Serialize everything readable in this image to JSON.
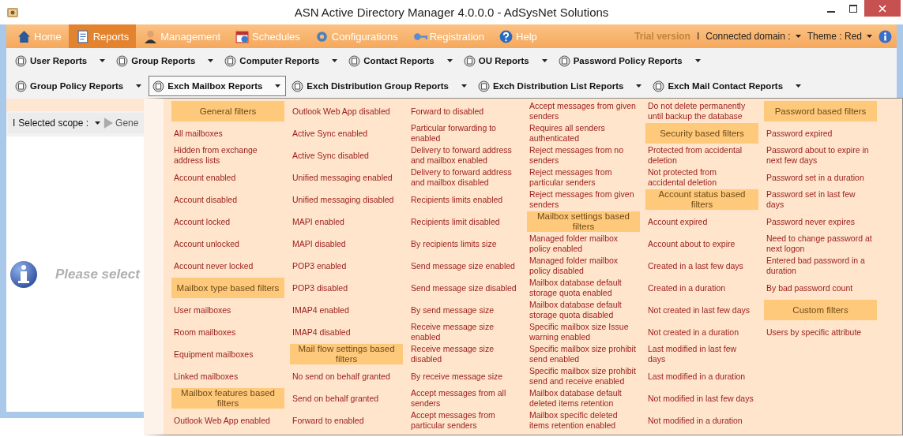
{
  "window": {
    "title": "ASN Active Directory Manager 4.0.0.0 - AdSysNet Solutions"
  },
  "tabs": [
    {
      "label": "Home",
      "selected": false
    },
    {
      "label": "Reports",
      "selected": true
    },
    {
      "label": "Management",
      "selected": false
    },
    {
      "label": "Schedules",
      "selected": false
    },
    {
      "label": "Configurations",
      "selected": false
    },
    {
      "label": "Registration",
      "selected": false
    },
    {
      "label": "Help",
      "selected": false
    }
  ],
  "header_right": {
    "trial": "Trial version",
    "separator": "I",
    "domain_label": "Connected domain :",
    "theme": "Theme : Red"
  },
  "toolbar_rows": [
    [
      {
        "label": "User Reports",
        "selected": false
      },
      {
        "label": "Group Reports",
        "selected": false
      },
      {
        "label": "Computer Reports",
        "selected": false
      },
      {
        "label": "Contact Reports",
        "selected": false
      },
      {
        "label": "OU Reports",
        "selected": false
      },
      {
        "label": "Password Policy Reports",
        "selected": false
      }
    ],
    [
      {
        "label": "Group Policy Reports",
        "selected": false
      },
      {
        "label": "Exch Mailbox Reports",
        "selected": true
      },
      {
        "label": "Exch Distribution Group Reports",
        "selected": false
      },
      {
        "label": "Exch Distribution List Reports",
        "selected": false
      },
      {
        "label": "Exch Mail Contact Reports",
        "selected": false
      }
    ]
  ],
  "scope_bar": {
    "separator": "I",
    "label": "Selected scope :",
    "generate": "Gene"
  },
  "content": {
    "message": "Please select"
  },
  "menu": {
    "columns": [
      [
        {
          "kind": "header",
          "label": "General filters"
        },
        {
          "kind": "item",
          "label": "All mailboxes"
        },
        {
          "kind": "item",
          "label": "Hidden from exchange address lists"
        },
        {
          "kind": "item",
          "label": "Account enabled"
        },
        {
          "kind": "item",
          "label": "Account disabled"
        },
        {
          "kind": "item",
          "label": "Account locked"
        },
        {
          "kind": "item",
          "label": "Account unlocked"
        },
        {
          "kind": "item",
          "label": "Account never locked"
        },
        {
          "kind": "header",
          "label": "Mailbox type based filters"
        },
        {
          "kind": "item",
          "label": "User mailboxes"
        },
        {
          "kind": "item",
          "label": "Room mailboxes"
        },
        {
          "kind": "item",
          "label": "Equipment mailboxes"
        },
        {
          "kind": "item",
          "label": "Linked mailboxes"
        },
        {
          "kind": "header",
          "label": "Mailbox features based filters"
        },
        {
          "kind": "item",
          "label": "Outlook Web App enabled"
        }
      ],
      [
        {
          "kind": "item",
          "label": "Outlook Web App disabled"
        },
        {
          "kind": "item",
          "label": "Active Sync enabled"
        },
        {
          "kind": "item",
          "label": "Active Sync disabled"
        },
        {
          "kind": "item",
          "label": "Unified messaging enabled"
        },
        {
          "kind": "item",
          "label": "Unified messaging disabled"
        },
        {
          "kind": "item",
          "label": "MAPI enabled"
        },
        {
          "kind": "item",
          "label": "MAPI disabled"
        },
        {
          "kind": "item",
          "label": "POP3 enabled"
        },
        {
          "kind": "item",
          "label": "POP3 disabled"
        },
        {
          "kind": "item",
          "label": "IMAP4 enabled"
        },
        {
          "kind": "item",
          "label": "IMAP4 disabled"
        },
        {
          "kind": "header",
          "label": "Mail flow settings based filters"
        },
        {
          "kind": "item",
          "label": "No send on behalf granted"
        },
        {
          "kind": "item",
          "label": "Send on behalf granted"
        },
        {
          "kind": "item",
          "label": "Forward to enabled"
        }
      ],
      [
        {
          "kind": "item",
          "label": "Forward to disabled"
        },
        {
          "kind": "item",
          "label": "Particular forwarding to enabled"
        },
        {
          "kind": "item",
          "label": "Delivery to forward address and mailbox enabled"
        },
        {
          "kind": "item",
          "label": "Delivery to forward address and mailbox disabled"
        },
        {
          "kind": "item",
          "label": "Recipients limits enabled"
        },
        {
          "kind": "item",
          "label": "Recipients limit disabled"
        },
        {
          "kind": "item",
          "label": "By recipients limits size"
        },
        {
          "kind": "item",
          "label": "Send message size enabled"
        },
        {
          "kind": "item",
          "label": "Send message size disabled"
        },
        {
          "kind": "item",
          "label": "By send message size"
        },
        {
          "kind": "item",
          "label": "Receive message size enabled"
        },
        {
          "kind": "item",
          "label": "Receive message size disabled"
        },
        {
          "kind": "item",
          "label": "By receive message size"
        },
        {
          "kind": "item",
          "label": "Accept messages from all senders"
        },
        {
          "kind": "item",
          "label": "Accept messages from particular senders"
        }
      ],
      [
        {
          "kind": "item",
          "label": "Accept messages from given senders"
        },
        {
          "kind": "item",
          "label": "Requires all senders authenticated"
        },
        {
          "kind": "item",
          "label": "Reject messages from no senders"
        },
        {
          "kind": "item",
          "label": "Reject messages from particular senders"
        },
        {
          "kind": "item",
          "label": "Reject messages from given senders"
        },
        {
          "kind": "header",
          "label": "Mailbox settings based filters"
        },
        {
          "kind": "item",
          "label": "Managed folder mailbox policy enabled"
        },
        {
          "kind": "item",
          "label": "Managed folder mailbox policy disabled"
        },
        {
          "kind": "item",
          "label": "Mailbox database default storage quota enabled"
        },
        {
          "kind": "item",
          "label": "Mailbox database default storage quota disabled"
        },
        {
          "kind": "item",
          "label": "Specific mailbox size Issue warning enabled"
        },
        {
          "kind": "item",
          "label": "Specific mailbox size prohibit send enabled"
        },
        {
          "kind": "item",
          "label": "Specific mailbox size prohibit send and receive enabled"
        },
        {
          "kind": "item",
          "label": "Mailbox database default deleted items retention"
        },
        {
          "kind": "item",
          "label": "Mailbox specific deleted items retention enabled"
        }
      ],
      [
        {
          "kind": "item",
          "label": "Do not delete permanently until backup the database"
        },
        {
          "kind": "header",
          "label": "Security based filters"
        },
        {
          "kind": "item",
          "label": "Protected from accidental deletion"
        },
        {
          "kind": "item",
          "label": "Not protected from accidental deletion"
        },
        {
          "kind": "header",
          "label": "Account status based filters"
        },
        {
          "kind": "item",
          "label": "Account expired"
        },
        {
          "kind": "item",
          "label": "Account about to expire"
        },
        {
          "kind": "item",
          "label": "Created in a last few days"
        },
        {
          "kind": "item",
          "label": "Created in a duration"
        },
        {
          "kind": "item",
          "label": "Not created in last few days"
        },
        {
          "kind": "item",
          "label": "Not created in a duration"
        },
        {
          "kind": "item",
          "label": "Last modified in last few days"
        },
        {
          "kind": "item",
          "label": "Last modified in a duration"
        },
        {
          "kind": "item",
          "label": "Not modified in last few days"
        },
        {
          "kind": "item",
          "label": "Not modified in a duration"
        }
      ],
      [
        {
          "kind": "header",
          "label": "Password based filters"
        },
        {
          "kind": "item",
          "label": "Password expired"
        },
        {
          "kind": "item",
          "label": "Password about to expire in next few days"
        },
        {
          "kind": "item",
          "label": "Password set in a duration"
        },
        {
          "kind": "item",
          "label": "Password set in last few days"
        },
        {
          "kind": "item",
          "label": "Password never expires"
        },
        {
          "kind": "item",
          "label": "Need to change password at next logon"
        },
        {
          "kind": "item",
          "label": "Entered bad password in a duration"
        },
        {
          "kind": "item",
          "label": "By bad password count"
        },
        {
          "kind": "header",
          "label": "Custom filters"
        },
        {
          "kind": "item",
          "label": "Users by specific attribute"
        }
      ]
    ]
  }
}
